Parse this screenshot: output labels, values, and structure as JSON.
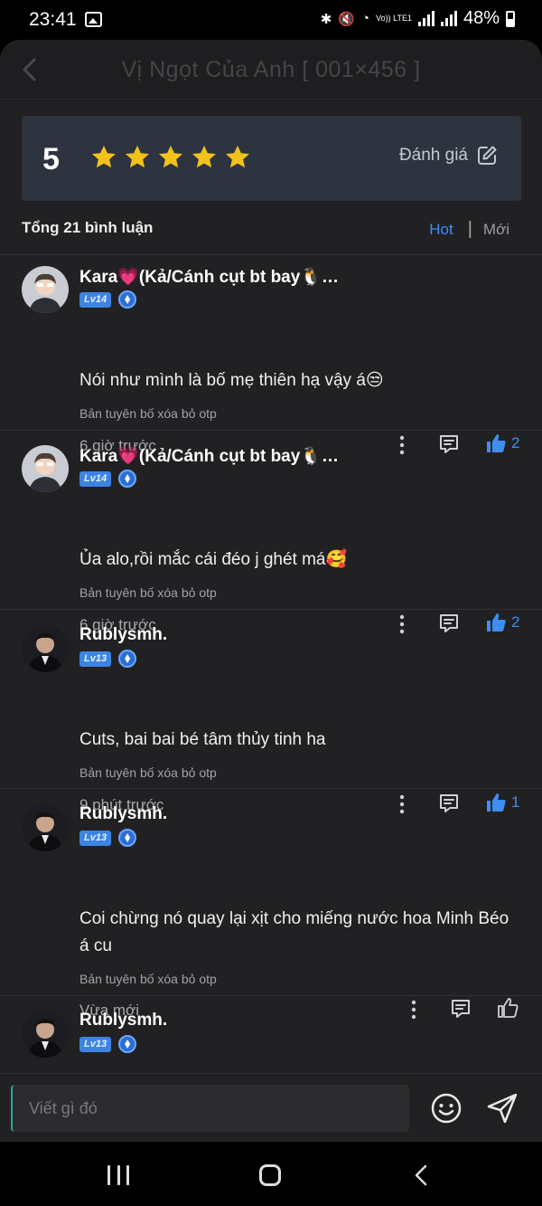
{
  "status": {
    "time": "23:41",
    "battery": "48%",
    "network": "Vo)) LTE1",
    "icons": [
      "image-icon",
      "bluetooth-icon",
      "mute-icon",
      "wifi-icon",
      "signal-icon",
      "battery-icon"
    ]
  },
  "header": {
    "title": "Vị Ngọt Của Anh [ 001×456 ]",
    "back_icon": "chevron-left-icon"
  },
  "rating": {
    "score": "5",
    "stars": 5,
    "rate_label": "Đánh giá",
    "star_color": "#f2c21b"
  },
  "list": {
    "total": "Tổng 21 bình luận",
    "sort_hot": "Hot",
    "sort_sep": "|",
    "sort_new": "Mới"
  },
  "comments": [
    {
      "name": "Kara💗(Kả/Cánh cụt bt bay🐧…",
      "level": "Lv14",
      "text": "Nói như mình là bố mẹ thiên hạ vậy á😒",
      "sub": "Bản tuyên bố xóa bỏ otp",
      "time": "6 giờ trước",
      "likes": "2",
      "liked": true
    },
    {
      "name": "Kara💗(Kả/Cánh cụt bt bay🐧…",
      "level": "Lv14",
      "text": "Ủa alo,rồi mắc cái đéo j ghét má🥰",
      "sub": "Bản tuyên bố xóa bỏ otp",
      "time": "6 giờ trước",
      "likes": "2",
      "liked": true
    },
    {
      "name": "Rublysmh.",
      "level": "Lv13",
      "text": "Cuts, bai bai bé tâm thủy tinh ha",
      "sub": "Bản tuyên bố xóa bỏ otp",
      "time": "9 phút trước",
      "likes": "1",
      "liked": true
    },
    {
      "name": "Rublysmh.",
      "level": "Lv13",
      "text": "Coi chừng nó quay lại xịt cho miếng nước hoa Minh Béo á cu",
      "sub": "Bản tuyên bố xóa bỏ otp",
      "time": "Vừa mới",
      "likes": "",
      "liked": false
    },
    {
      "name": "Rublysmh.",
      "level": "Lv13"
    }
  ],
  "composer": {
    "placeholder": "Viết gì đó"
  },
  "colors": {
    "accent": "#3f8ef0",
    "background": "#212123",
    "card": "#2e3340"
  }
}
